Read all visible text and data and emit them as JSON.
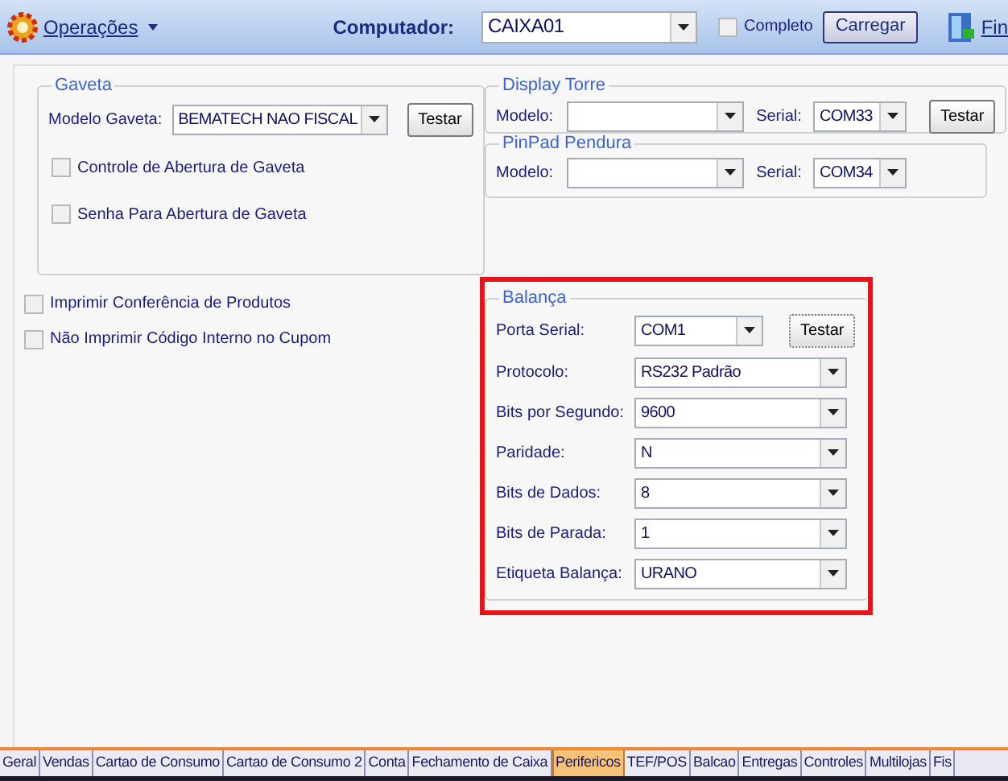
{
  "toolbar": {
    "menu": "Operações",
    "computer_label": "Computador:",
    "computer_value": "CAIXA01",
    "complete": {
      "label": "Completo",
      "checked": false
    },
    "load_button": "Carregar",
    "exit": "Fin"
  },
  "gaveta": {
    "title": "Gaveta",
    "model_label": "Modelo Gaveta:",
    "model_value": "BEMATECH NAO FISCAL",
    "test_button": "Testar",
    "options": [
      {
        "label": "Controle de Abertura de Gaveta",
        "checked": false
      },
      {
        "label": "Senha Para Abertura de Gaveta",
        "checked": false
      }
    ]
  },
  "options": [
    {
      "label": "Imprimir Conferência de Produtos",
      "checked": false
    },
    {
      "label": "Não Imprimir Código Interno no Cupom",
      "checked": false
    }
  ],
  "display_torre": {
    "title": "Display Torre",
    "model_label": "Modelo:",
    "serial_label": "Serial:",
    "serial_value": "COM33",
    "test_button": "Testar"
  },
  "pinpad": {
    "title": "PinPad Pendura",
    "model_label": "Modelo:",
    "serial_label": "Serial:",
    "serial_value": "COM34"
  },
  "balanca": {
    "title": "Balança",
    "test_button": "Testar",
    "fields": [
      {
        "label": "Porta Serial:",
        "value": "COM1"
      },
      {
        "label": "Protocolo:",
        "value": "RS232 Padrão"
      },
      {
        "label": "Bits por Segundo:",
        "value": "9600"
      },
      {
        "label": "Paridade:",
        "value": "N"
      },
      {
        "label": "Bits de Dados:",
        "value": "8"
      },
      {
        "label": "Bits de Parada:",
        "value": "1"
      },
      {
        "label": "Etiqueta Balança:",
        "value": "URANO"
      }
    ]
  },
  "tabs": [
    {
      "label": "Geral",
      "selected": false
    },
    {
      "label": "Vendas",
      "selected": false
    },
    {
      "label": "Cartao de Consumo",
      "selected": false
    },
    {
      "label": "Cartao de Consumo 2",
      "selected": false
    },
    {
      "label": "Conta",
      "selected": false
    },
    {
      "label": "Fechamento de Caixa",
      "selected": false
    },
    {
      "label": "Perifericos",
      "selected": true
    },
    {
      "label": "TEF/POS",
      "selected": false
    },
    {
      "label": "Balcao",
      "selected": false
    },
    {
      "label": "Entregas",
      "selected": false
    },
    {
      "label": "Controles",
      "selected": false
    },
    {
      "label": "Multilojas",
      "selected": false
    },
    {
      "label": "Fis",
      "selected": false
    }
  ]
}
